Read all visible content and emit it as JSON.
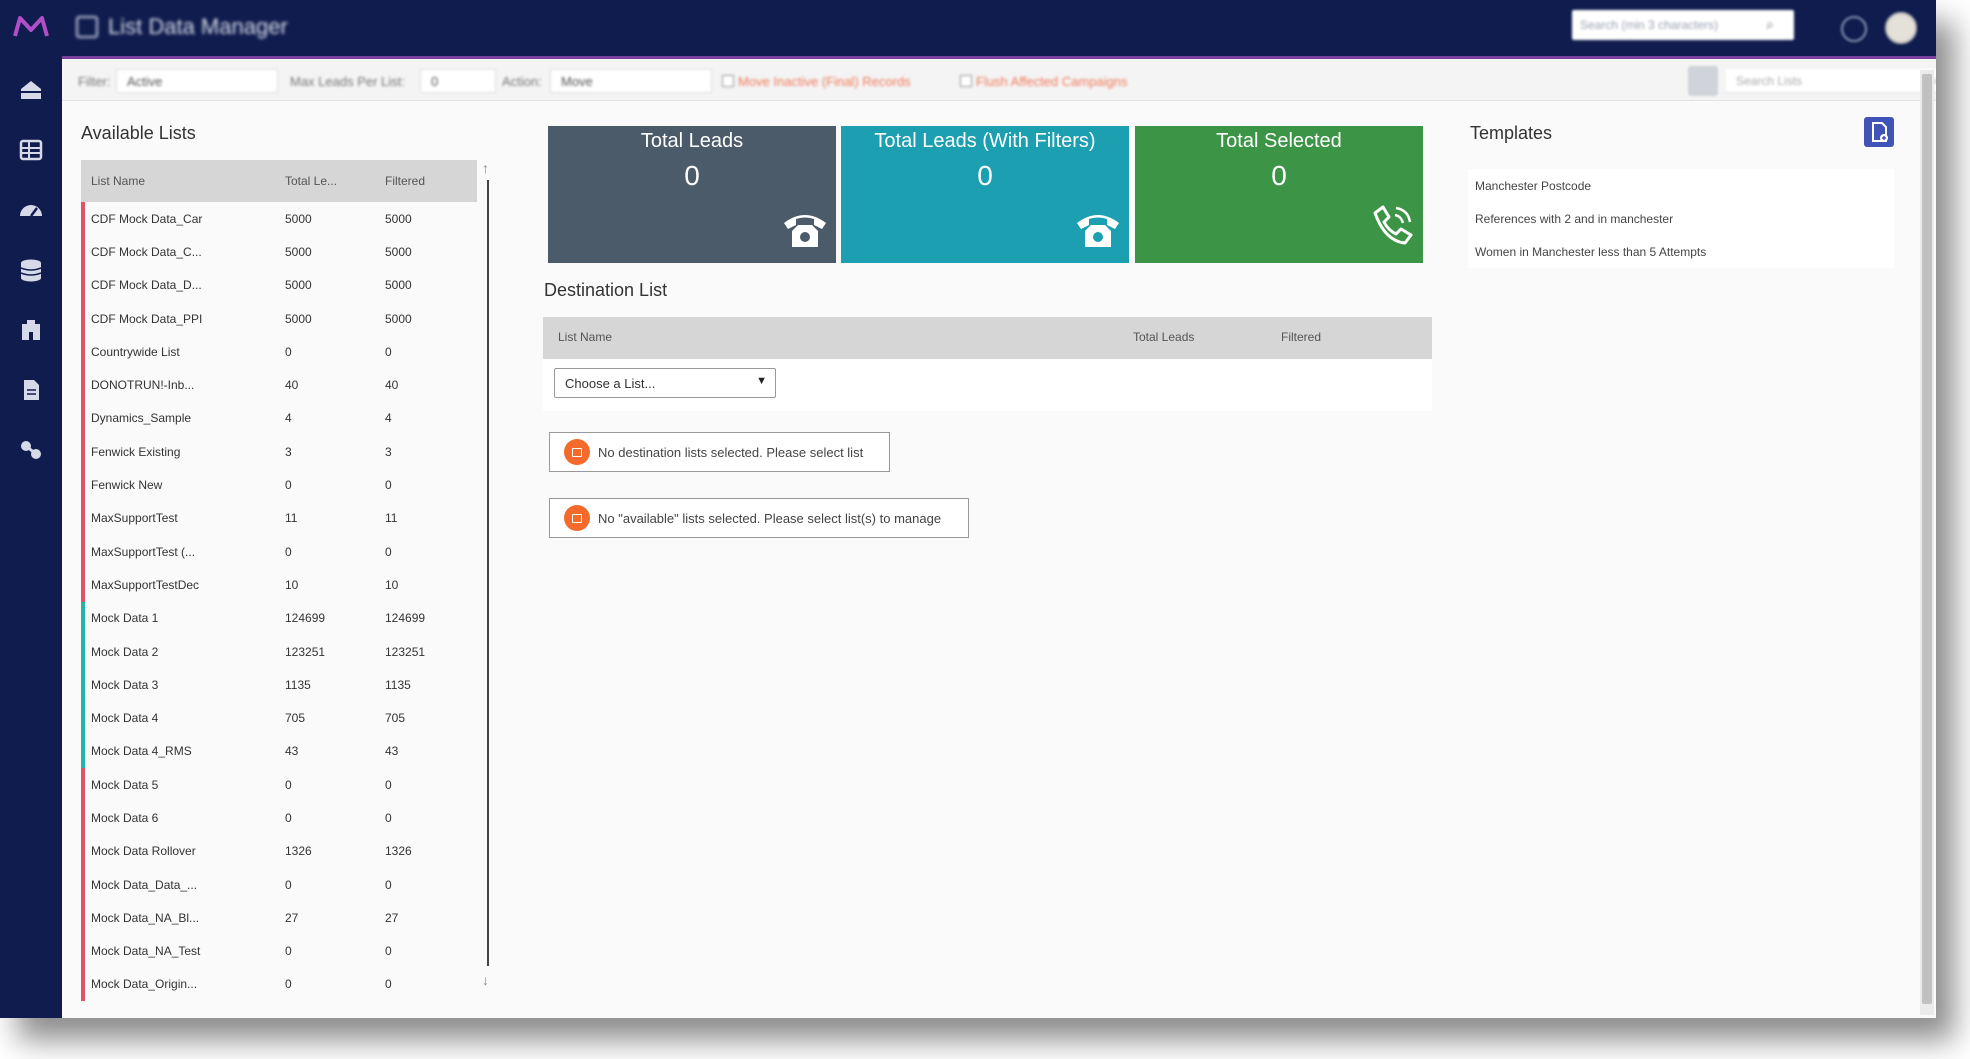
{
  "header": {
    "app_title": "List Data Manager",
    "search_placeholder": "Search (min 3 characters)"
  },
  "filter_bar": {
    "filter_label": "Filter:",
    "filter_value": "Active",
    "max_leads_label": "Max Leads Per List:",
    "max_leads_value": "0",
    "action_label": "Action:",
    "action_value": "Move",
    "option1": "Move Inactive (Final) Records",
    "option2": "Flush Affected Campaigns",
    "list_search_placeholder": "Search Lists"
  },
  "available_lists": {
    "title": "Available Lists",
    "columns": [
      "List Name",
      "Total Le...",
      "Filtered"
    ],
    "rows": [
      {
        "name": "CDF Mock Data_Car",
        "total": "5000",
        "filtered": "5000",
        "color": "#e05565"
      },
      {
        "name": "CDF Mock Data_C...",
        "total": "5000",
        "filtered": "5000",
        "color": "#e05565"
      },
      {
        "name": "CDF Mock Data_D...",
        "total": "5000",
        "filtered": "5000",
        "color": "#e05565"
      },
      {
        "name": "CDF Mock Data_PPI",
        "total": "5000",
        "filtered": "5000",
        "color": "#e05565"
      },
      {
        "name": "Countrywide List",
        "total": "0",
        "filtered": "0",
        "color": "#e05565"
      },
      {
        "name": "DONOTRUN!-Inb...",
        "total": "40",
        "filtered": "40",
        "color": "#e05565"
      },
      {
        "name": "Dynamics_Sample",
        "total": "4",
        "filtered": "4",
        "color": "#e05565"
      },
      {
        "name": "Fenwick Existing",
        "total": "3",
        "filtered": "3",
        "color": "#e05565"
      },
      {
        "name": "Fenwick New",
        "total": "0",
        "filtered": "0",
        "color": "#e05565"
      },
      {
        "name": "MaxSupportTest",
        "total": "11",
        "filtered": "11",
        "color": "#e05565"
      },
      {
        "name": "MaxSupportTest (...",
        "total": "0",
        "filtered": "0",
        "color": "#e05565"
      },
      {
        "name": "MaxSupportTestDec",
        "total": "10",
        "filtered": "10",
        "color": "#e05565"
      },
      {
        "name": "Mock Data 1",
        "total": "124699",
        "filtered": "124699",
        "color": "#1fb5a8"
      },
      {
        "name": "Mock Data 2",
        "total": "123251",
        "filtered": "123251",
        "color": "#1fb5a8"
      },
      {
        "name": "Mock Data 3",
        "total": "1135",
        "filtered": "1135",
        "color": "#1fb5a8"
      },
      {
        "name": "Mock Data 4",
        "total": "705",
        "filtered": "705",
        "color": "#1fb5a8"
      },
      {
        "name": "Mock Data 4_RMS",
        "total": "43",
        "filtered": "43",
        "color": "#1fb5a8"
      },
      {
        "name": "Mock Data 5",
        "total": "0",
        "filtered": "0",
        "color": "#e05565"
      },
      {
        "name": "Mock Data 6",
        "total": "0",
        "filtered": "0",
        "color": "#e05565"
      },
      {
        "name": "Mock Data Rollover",
        "total": "1326",
        "filtered": "1326",
        "color": "#e05565"
      },
      {
        "name": "Mock Data_Data_...",
        "total": "0",
        "filtered": "0",
        "color": "#e05565"
      },
      {
        "name": "Mock Data_NA_Bl...",
        "total": "27",
        "filtered": "27",
        "color": "#e05565"
      },
      {
        "name": "Mock Data_NA_Test",
        "total": "0",
        "filtered": "0",
        "color": "#e05565"
      },
      {
        "name": "Mock Data_Origin...",
        "total": "0",
        "filtered": "0",
        "color": "#e05565"
      }
    ]
  },
  "stats": {
    "total_leads": {
      "label": "Total Leads",
      "value": "0",
      "color": "#4b5b69"
    },
    "total_leads_filters": {
      "label": "Total Leads (With Filters)",
      "value": "0",
      "color": "#1c9fb0"
    },
    "total_selected": {
      "label": "Total Selected",
      "value": "0",
      "color": "#3c9447"
    }
  },
  "destination": {
    "title": "Destination List",
    "columns": [
      "List Name",
      "Total Leads",
      "Filtered"
    ],
    "select_value": "Choose a List...",
    "alert_destination": "No destination lists selected. Please select list",
    "alert_available": "No \"available\" lists selected. Please select list(s) to manage"
  },
  "templates": {
    "title": "Templates",
    "items": [
      "Manchester Postcode",
      "References with 2 and in manchester",
      "Women in Manchester less than 5 Attempts"
    ]
  },
  "icons": {
    "logo": "brand-logo-icon",
    "sidebar": [
      "home-icon",
      "list-icon",
      "dashboard-gauge-icon",
      "database-icon",
      "building-icon",
      "document-icon",
      "settings-link-icon"
    ]
  }
}
